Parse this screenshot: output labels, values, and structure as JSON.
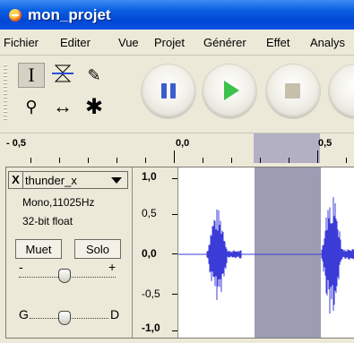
{
  "window": {
    "title": "mon_projet"
  },
  "menu": [
    "Fichier",
    "Editer",
    "Vue",
    "Projet",
    "Générer",
    "Effet",
    "Analys"
  ],
  "tools": {
    "selection": "I",
    "draw": "✎",
    "zoom": "⚲",
    "timeshift": "↔",
    "multi": "✱"
  },
  "transport": {
    "pause_icon": "pause-icon",
    "play_icon": "play-icon",
    "stop_icon": "stop-icon",
    "accent_pause": "#3a5fcd",
    "accent_play": "#3cc14a"
  },
  "timeline": {
    "labels": [
      "- 0,5",
      "0,0",
      "0,5"
    ]
  },
  "track": {
    "name": "thunder_x",
    "close_label": "X",
    "format": "Mono,11025Hz",
    "depth": "32-bit float",
    "mute_label": "Muet",
    "solo_label": "Solo",
    "gain_min": "-",
    "gain_max": "+",
    "pan_left": "G",
    "pan_right": "D",
    "scale_labels": [
      "1,0",
      "0,5",
      "0,0",
      "-0,5",
      "-1,0"
    ]
  },
  "colors": {
    "waveform": "#3b3bd8",
    "selection": "#9c9cb3",
    "titlebar": "#0a5fe0"
  }
}
